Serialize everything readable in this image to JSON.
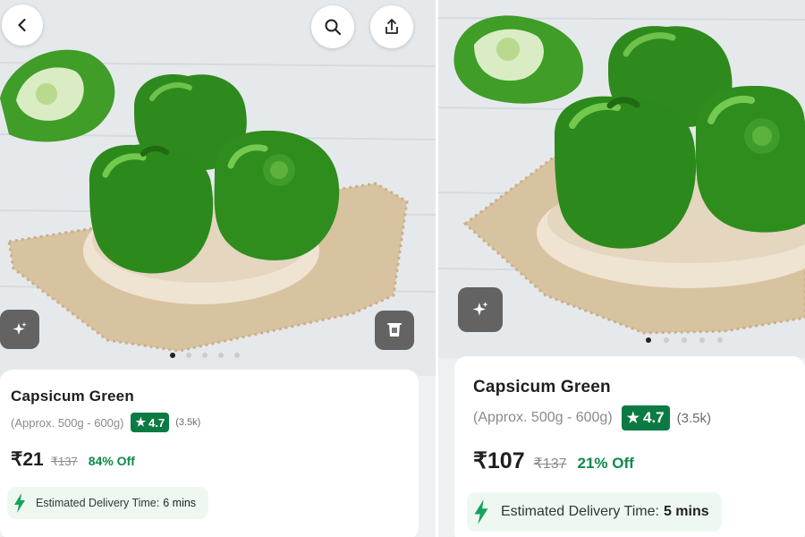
{
  "screens": [
    {
      "product": {
        "name": "Capsicum Green",
        "weight": "(Approx. 500g - 600g)",
        "rating": "4.7",
        "reviews": "(3.5k)",
        "price": "₹21",
        "mrp": "₹137",
        "discount": "84% Off"
      },
      "delivery": {
        "label": "Estimated Delivery Time:",
        "time": "6 mins"
      },
      "carousel": {
        "total": 5,
        "active": 1
      },
      "icons": [
        "back-arrow-icon",
        "search-icon",
        "share-icon",
        "sparkle-icon",
        "cup-icon"
      ]
    },
    {
      "product": {
        "name": "Capsicum Green",
        "weight": "(Approx. 500g - 600g)",
        "rating": "4.7",
        "reviews": "(3.5k)",
        "price": "₹107",
        "mrp": "₹137",
        "discount": "21% Off"
      },
      "delivery": {
        "label": "Estimated Delivery Time:",
        "time": "5 mins"
      },
      "carousel": {
        "total": 5,
        "active": 1
      },
      "icons": [
        "sparkle-icon"
      ]
    }
  ],
  "colors": {
    "rating_badge": "#0c7a43",
    "discount_text": "#0c8a4a",
    "delivery_bg": "#eef8f1",
    "bolt_icon": "#17a35a"
  }
}
